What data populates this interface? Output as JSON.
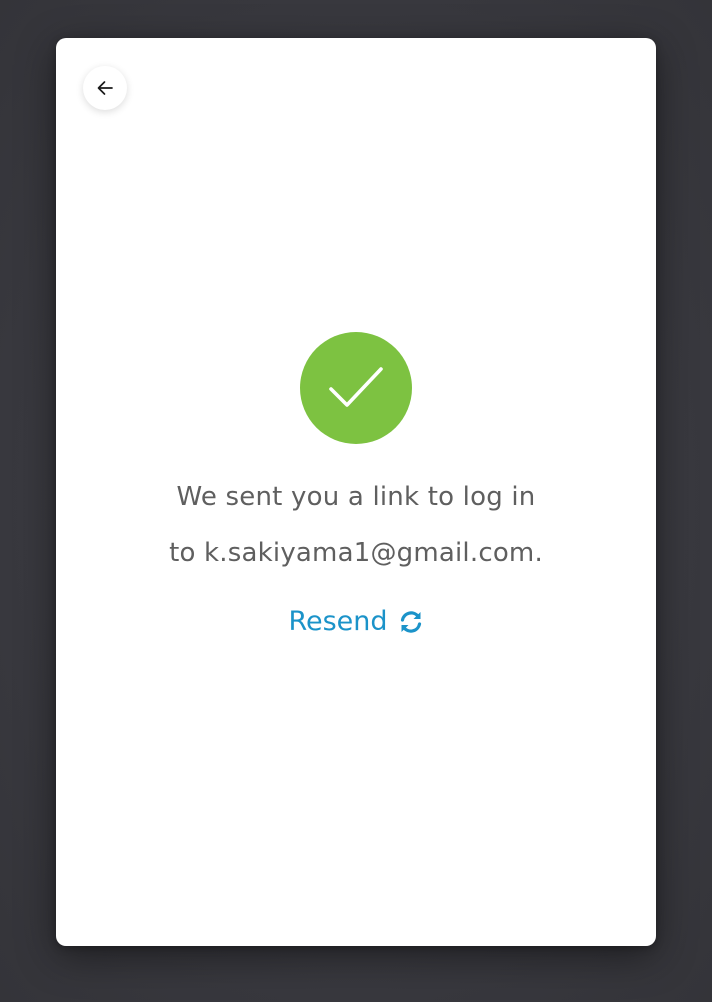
{
  "confirmation": {
    "line1": "We sent you a link to log in",
    "line2": "to k.sakiyama1@gmail.com.",
    "resend_label": "Resend"
  },
  "icons": {
    "back": "arrow-left-icon",
    "success": "checkmark-icon",
    "resend": "refresh-icon"
  },
  "colors": {
    "success_green": "#7dc241",
    "link_blue": "#1b93c9",
    "text_gray": "#5f5f5f",
    "backdrop": "#3c3c42"
  }
}
